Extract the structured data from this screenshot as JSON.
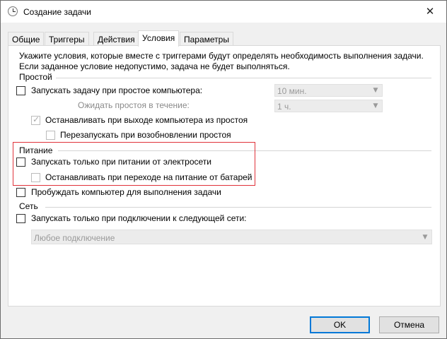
{
  "window": {
    "title": "Создание задачи",
    "icon": "clock-icon",
    "close_glyph": "✕"
  },
  "tabs": [
    {
      "label": "Общие"
    },
    {
      "label": "Триггеры"
    },
    {
      "label": "Действия"
    },
    {
      "label": "Условия",
      "active": true
    },
    {
      "label": "Параметры"
    }
  ],
  "description": {
    "line1": "Укажите условия, которые вместе с триггерами будут определять необходимость выполнения задачи.",
    "line2": "Если заданное условие недопустимо, задача не будет выполняться."
  },
  "idle": {
    "group_label": "Простой",
    "start_if_idle": {
      "label": "Запускать задачу при простое компьютера:",
      "checked": false
    },
    "idle_duration": "10 мин.",
    "wait_label": "Ожидать простоя в течение:",
    "wait_duration": "1 ч.",
    "stop_on_idle_end": {
      "label": "Останавливать при выходе компьютера из простоя",
      "checked": true,
      "disabled": true
    },
    "restart_on_idle": {
      "label": "Перезапускать при возобновлении простоя",
      "checked": false,
      "disabled": true
    }
  },
  "power": {
    "group_label": "Питание",
    "ac_only": {
      "label": "Запускать только при питании от электросети",
      "checked": false
    },
    "stop_on_battery": {
      "label": "Останавливать при переходе на питание от батарей",
      "checked": false,
      "disabled": true
    },
    "highlight_color": "#e0323a"
  },
  "wake": {
    "label": "Пробуждать компьютер для выполнения задачи",
    "checked": false
  },
  "network": {
    "group_label": "Сеть",
    "only_if_network": {
      "label": "Запускать только при подключении к следующей сети:",
      "checked": false
    },
    "connection": "Любое подключение"
  },
  "buttons": {
    "ok": "OK",
    "cancel": "Отмена"
  },
  "colors": {
    "accent": "#0078d7",
    "disabled_text": "#8a8a8a"
  }
}
